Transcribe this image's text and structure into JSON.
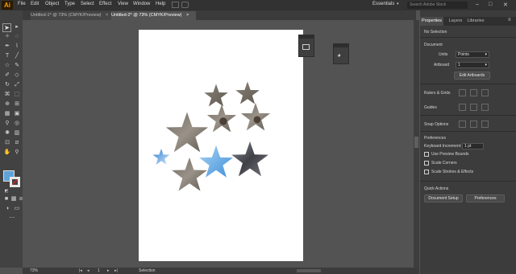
{
  "app": {
    "logo": "Ai"
  },
  "menu": [
    "File",
    "Edit",
    "Object",
    "Type",
    "Select",
    "Effect",
    "View",
    "Window",
    "Help"
  ],
  "header": {
    "workspace": "Essentials",
    "search_placeholder": "Search Adobe Stock"
  },
  "tabs": [
    {
      "label": "Untitled-1* @ 73% (CMYK/Preview)"
    },
    {
      "label": "Untitled-2* @ 73% (CMYK/Preview)"
    }
  ],
  "status": {
    "zoom": "73%",
    "artboard_num": "1",
    "tool": "Selection"
  },
  "panel": {
    "tabs": [
      "Properties",
      "Layers",
      "Libraries"
    ],
    "selection": "No Selection",
    "document_title": "Document",
    "units_label": "Units",
    "units_value": "Points",
    "artboard_label": "Artboard",
    "artboard_value": "1",
    "edit_artboards": "Edit Artboards",
    "rulers_label": "Rulers & Grids",
    "guides_label": "Guides",
    "snap_label": "Snap Options",
    "prefs_title": "Preferences",
    "keyboard_inc_label": "Keyboard Increment:",
    "keyboard_inc_value": "1 pt",
    "use_preview_bounds": "Use Preview Bounds",
    "scale_corners": "Scale Corners",
    "scale_strokes": "Scale Strokes & Effects",
    "quick_actions": "Quick Actions",
    "doc_setup": "Document Setup",
    "preferences_btn": "Preferences"
  },
  "colors": {
    "accent_blue": "#4a9ee8",
    "fill_swatch": "#5fa2d8"
  }
}
